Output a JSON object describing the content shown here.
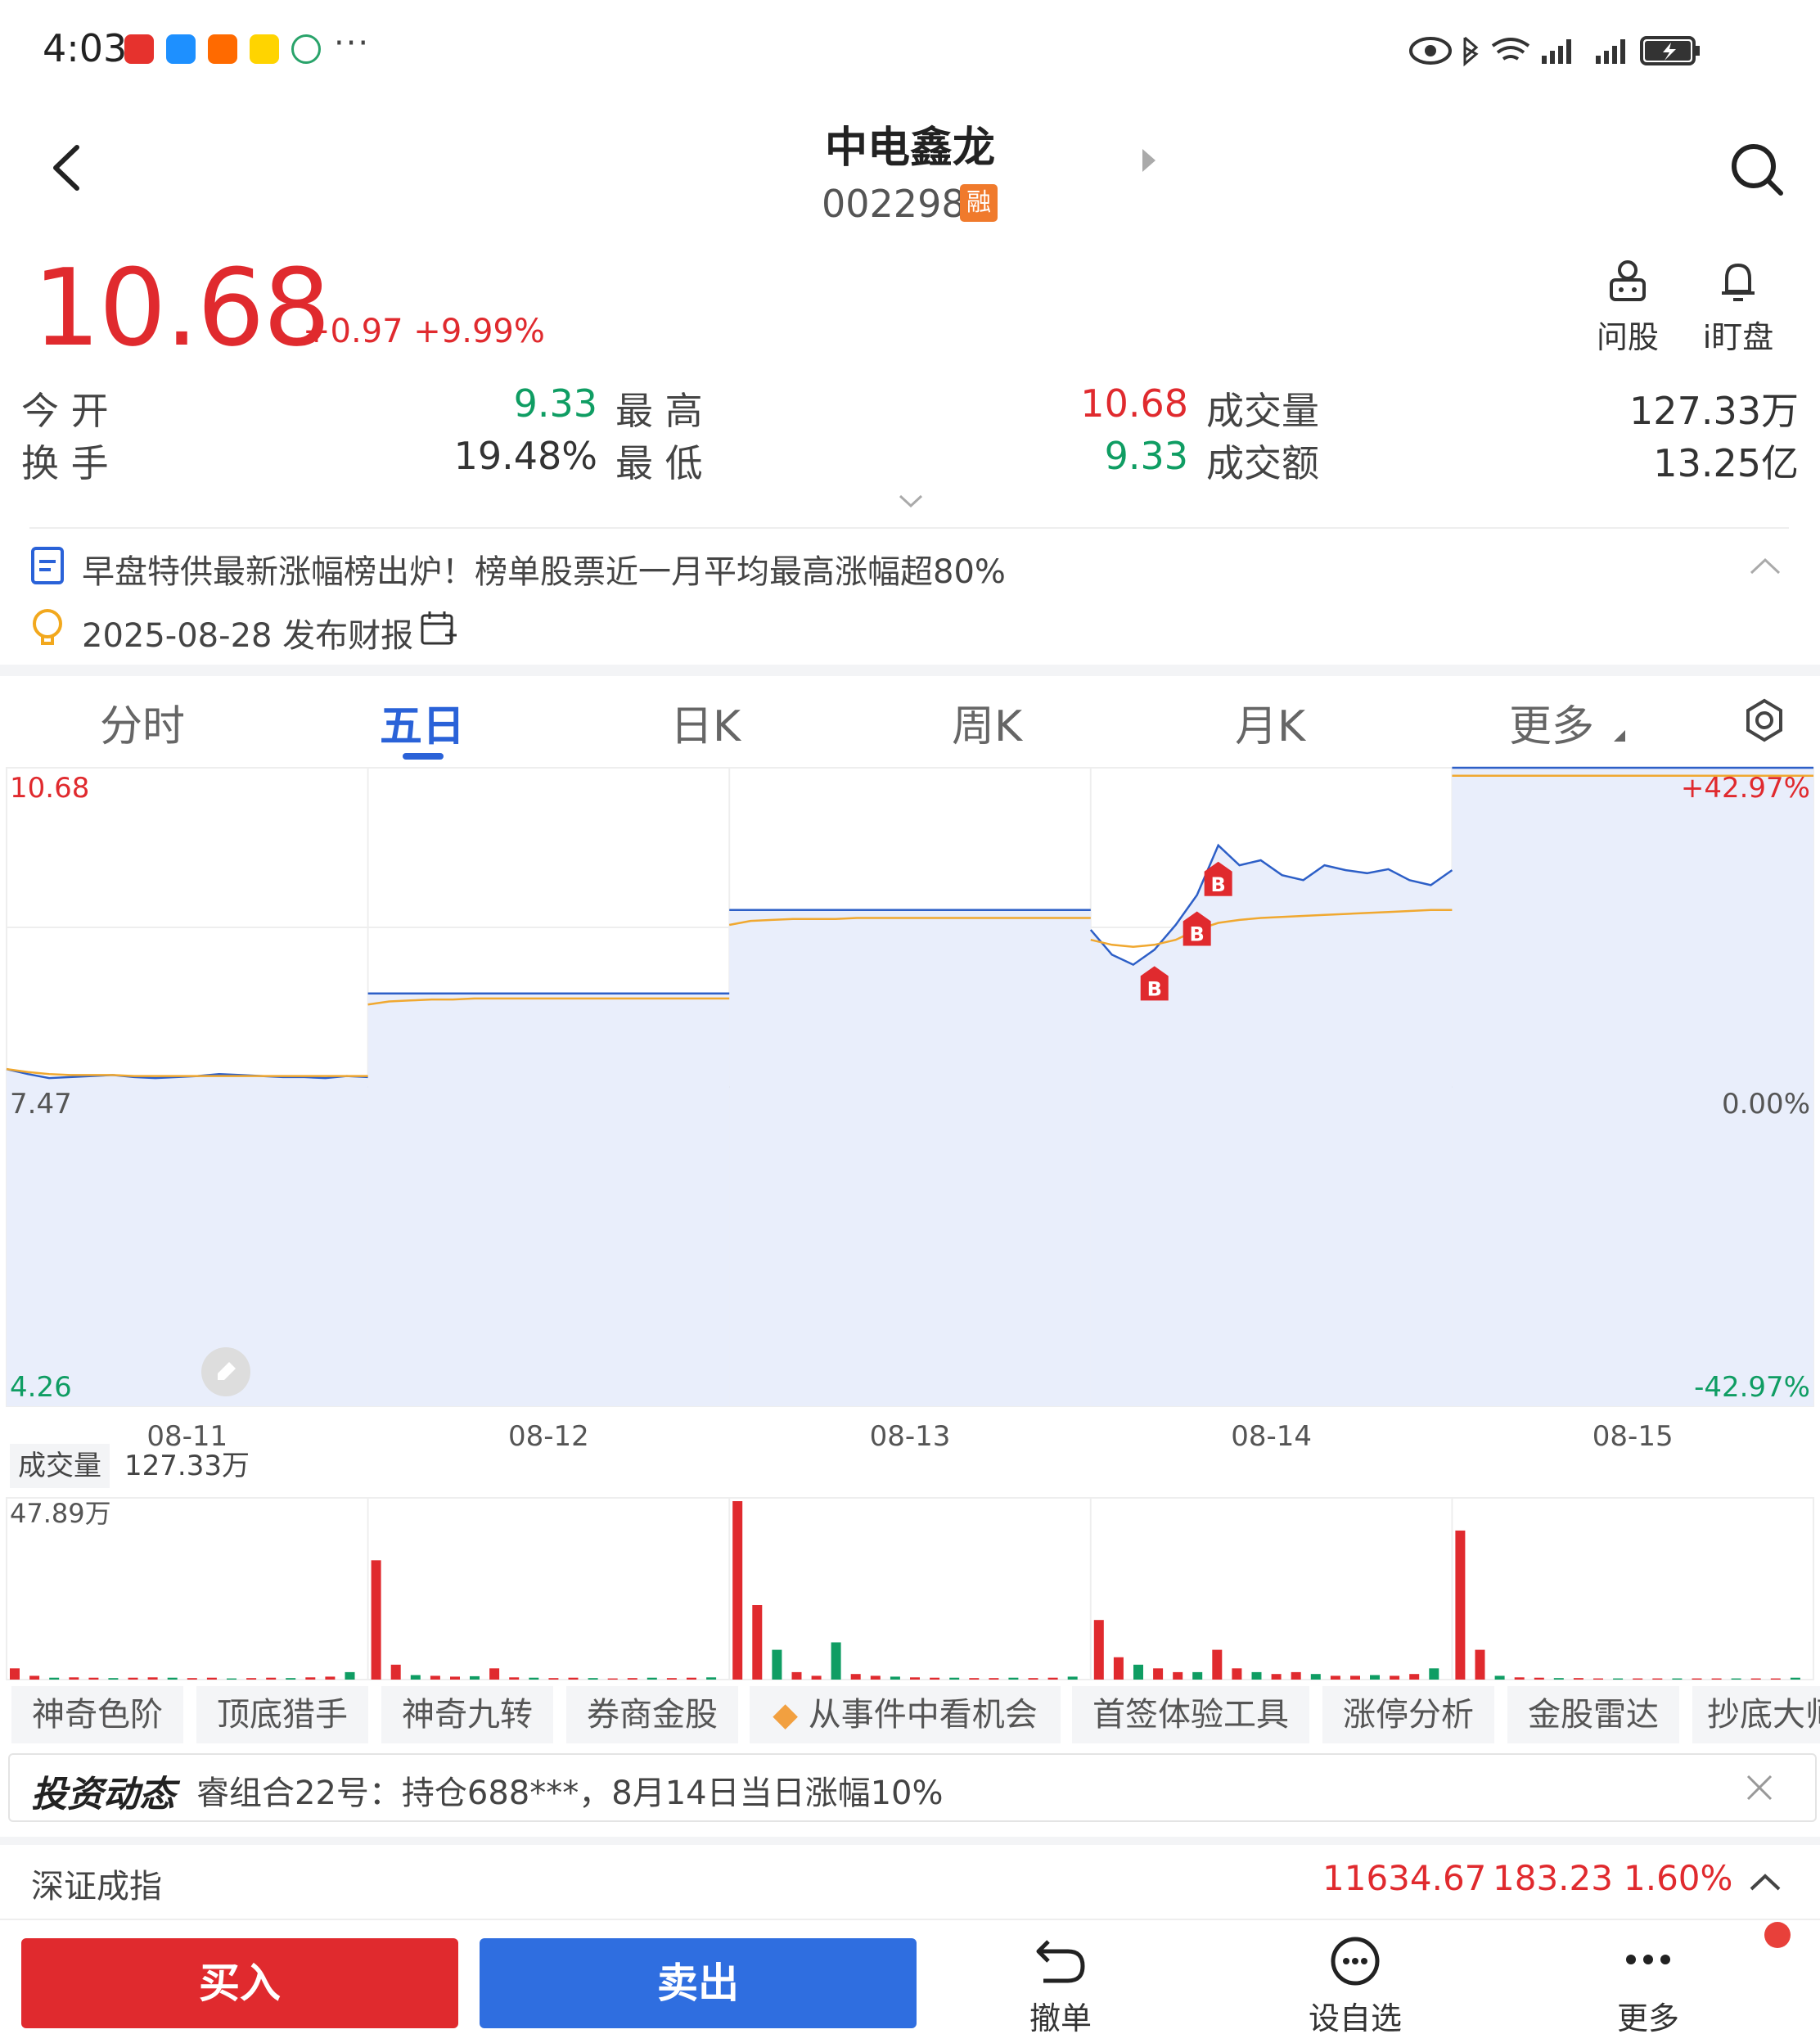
{
  "status_bar": {
    "time": "4:03",
    "dots": "···"
  },
  "header": {
    "title": "中电鑫龙",
    "code": "002298",
    "badge": "融"
  },
  "quote": {
    "price": "10.68",
    "change": "+0.97",
    "change_pct": "+9.99%"
  },
  "actions": {
    "wengu": "问股",
    "idingpan": "i盯盘"
  },
  "stats": {
    "open_label": "今  开",
    "open": "9.33",
    "high_label": "最  高",
    "high": "10.68",
    "vol_label": "成交量",
    "vol": "127.33万",
    "turnover_label": "换  手",
    "turnover": "19.48%",
    "low_label": "最  低",
    "low": "9.33",
    "amount_label": "成交额",
    "amount": "13.25亿"
  },
  "news": {
    "headline": "早盘特供最新涨幅榜出炉！榜单股票近一月平均最高涨幅超80%",
    "event": "2025-08-28 发布财报"
  },
  "tabs": [
    "分时",
    "五日",
    "日K",
    "周K",
    "月K",
    "更多"
  ],
  "chart_data": {
    "type": "line",
    "y_left": {
      "top": "10.68",
      "mid": "7.47",
      "bottom": "4.26"
    },
    "y_right": {
      "top": "+42.97%",
      "mid": "0.00%",
      "bottom": "-42.97%"
    },
    "ylim": [
      4.26,
      10.68
    ],
    "days": [
      "08-11",
      "08-12",
      "08-13",
      "08-14",
      "08-15"
    ],
    "price_series": [
      [
        7.65,
        7.6,
        7.56,
        7.57,
        7.58,
        7.59,
        7.57,
        7.56,
        7.57,
        7.58,
        7.6,
        7.59,
        7.58,
        7.57,
        7.57,
        7.56,
        7.58,
        7.57
      ],
      [
        8.41,
        8.41,
        8.41,
        8.41,
        8.41,
        8.41,
        8.41,
        8.41,
        8.41,
        8.41,
        8.41,
        8.41,
        8.41,
        8.41,
        8.41,
        8.41,
        8.41,
        8.41
      ],
      [
        9.25,
        9.25,
        9.25,
        9.25,
        9.25,
        9.25,
        9.25,
        9.25,
        9.25,
        9.25,
        9.25,
        9.25,
        9.25,
        9.25,
        9.25,
        9.25,
        9.25,
        9.25
      ],
      [
        9.05,
        8.8,
        8.7,
        8.85,
        9.1,
        9.4,
        9.9,
        9.7,
        9.75,
        9.6,
        9.55,
        9.7,
        9.65,
        9.62,
        9.66,
        9.55,
        9.5,
        9.65
      ],
      [
        10.68,
        10.68,
        10.68,
        10.68,
        10.68,
        10.68,
        10.68,
        10.68,
        10.68,
        10.68,
        10.68,
        10.68,
        10.68,
        10.68,
        10.68,
        10.68,
        10.68,
        10.68
      ]
    ],
    "avg_series": [
      [
        7.65,
        7.62,
        7.6,
        7.59,
        7.59,
        7.59,
        7.58,
        7.58,
        7.58,
        7.58,
        7.58,
        7.58,
        7.58,
        7.58,
        7.58,
        7.58,
        7.58,
        7.58
      ],
      [
        8.3,
        8.33,
        8.34,
        8.35,
        8.35,
        8.36,
        8.36,
        8.36,
        8.36,
        8.36,
        8.36,
        8.36,
        8.36,
        8.36,
        8.36,
        8.36,
        8.36,
        8.36
      ],
      [
        9.1,
        9.14,
        9.15,
        9.16,
        9.16,
        9.16,
        9.17,
        9.17,
        9.17,
        9.17,
        9.17,
        9.17,
        9.17,
        9.17,
        9.17,
        9.17,
        9.17,
        9.17
      ],
      [
        8.95,
        8.9,
        8.88,
        8.9,
        8.95,
        9.05,
        9.12,
        9.15,
        9.17,
        9.18,
        9.19,
        9.2,
        9.21,
        9.22,
        9.23,
        9.24,
        9.25,
        9.25
      ],
      [
        10.6,
        10.6,
        10.6,
        10.6,
        10.6,
        10.6,
        10.6,
        10.6,
        10.6,
        10.6,
        10.6,
        10.6,
        10.6,
        10.6,
        10.6,
        10.6,
        10.6,
        10.6
      ]
    ],
    "markers": [
      {
        "day": 3,
        "index": 3,
        "label": "B"
      },
      {
        "day": 3,
        "index": 5,
        "label": "B"
      },
      {
        "day": 3,
        "index": 6,
        "label": "B"
      }
    ],
    "volume": {
      "label": "成交量",
      "value": "127.33万",
      "max_label": "47.89万",
      "max": 47.89,
      "bars": [
        [
          3,
          1,
          0.5,
          0.6,
          0.5,
          0.4,
          0.5,
          0.6,
          0.5,
          0.4,
          0.5,
          0.3,
          0.4,
          0.5,
          0.4,
          0.6,
          0.8,
          2
        ],
        [
          32,
          4,
          1.2,
          1,
          0.8,
          0.9,
          3,
          0.6,
          0.5,
          0.4,
          0.5,
          0.4,
          0.3,
          0.4,
          0.5,
          0.4,
          0.5,
          0.6
        ],
        [
          47.89,
          20,
          8,
          2,
          1,
          10,
          1.5,
          1,
          0.8,
          0.6,
          0.5,
          0.5,
          0.4,
          0.4,
          0.5,
          0.4,
          0.5,
          0.8
        ],
        [
          16,
          6,
          4,
          3,
          2,
          2,
          8,
          3,
          2,
          1.5,
          2,
          1.5,
          1,
          1,
          1.2,
          1,
          1.5,
          3
        ],
        [
          40,
          8,
          1,
          0.6,
          0.5,
          0.4,
          0.4,
          0.3,
          0.3,
          0.3,
          0.3,
          0.3,
          0.3,
          0.3,
          0.3,
          0.3,
          0.3,
          0.5
        ]
      ]
    }
  },
  "tags": [
    "神奇色阶",
    "顶底猎手",
    "神奇九转",
    "券商金股",
    "从事件中看机会",
    "首签体验工具",
    "涨停分析",
    "金股雷达",
    "抄底大师"
  ],
  "dynamic": {
    "brand": "投资动态",
    "text": "睿组合22号：持仓688***，8月14日当日涨幅10%"
  },
  "index": {
    "name": "深证成指",
    "value": "11634.67",
    "change": "183.23",
    "pct": "1.60%"
  },
  "bottom": {
    "buy": "买入",
    "sell": "卖出",
    "revoke": "撤单",
    "add": "设自选",
    "more": "更多"
  },
  "colors": {
    "up": "#e02a2e",
    "down": "#0f9d63",
    "accent": "#2a62d8",
    "line": "#2d5fc7",
    "avg": "#f0a830",
    "fill": "#e9eefb"
  }
}
